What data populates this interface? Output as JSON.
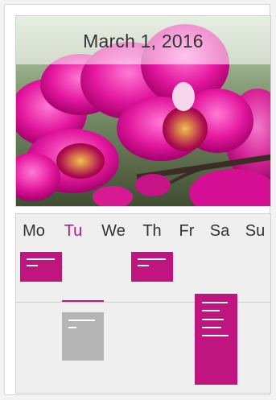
{
  "header": {
    "date_title": "March 1, 2016"
  },
  "colors": {
    "accent": "#c0157e",
    "event_gray": "#b5b5b5",
    "background": "#efefef"
  },
  "week": {
    "days": [
      "Mo",
      "Tu",
      "We",
      "Th",
      "Fr",
      "Sa",
      "Su"
    ],
    "active_day": "Tu"
  }
}
